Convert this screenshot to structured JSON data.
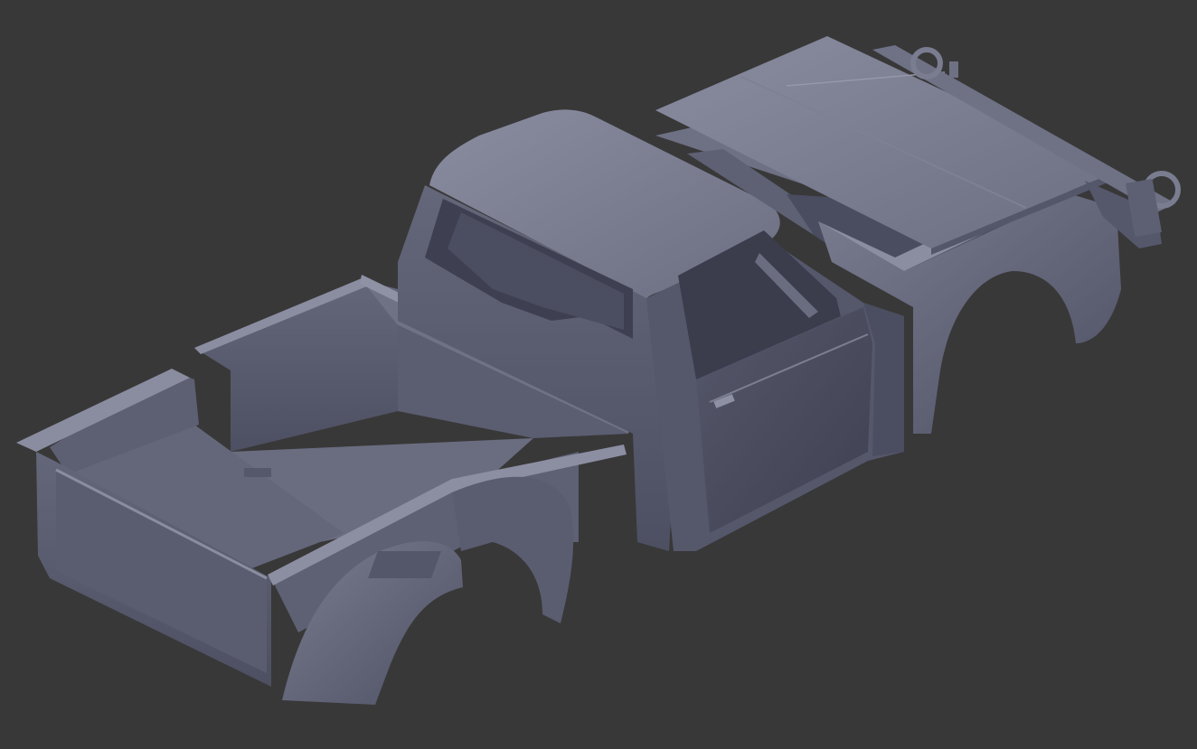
{
  "scene": {
    "subject": "3d-model-exploded-truck-body",
    "background_color": "#383838",
    "model_base_color": "#5f6072",
    "model_light_color": "#7e8095",
    "model_dark_color": "#45465a",
    "parts": [
      "bed",
      "cab",
      "hood",
      "front-fender",
      "bumper"
    ]
  }
}
